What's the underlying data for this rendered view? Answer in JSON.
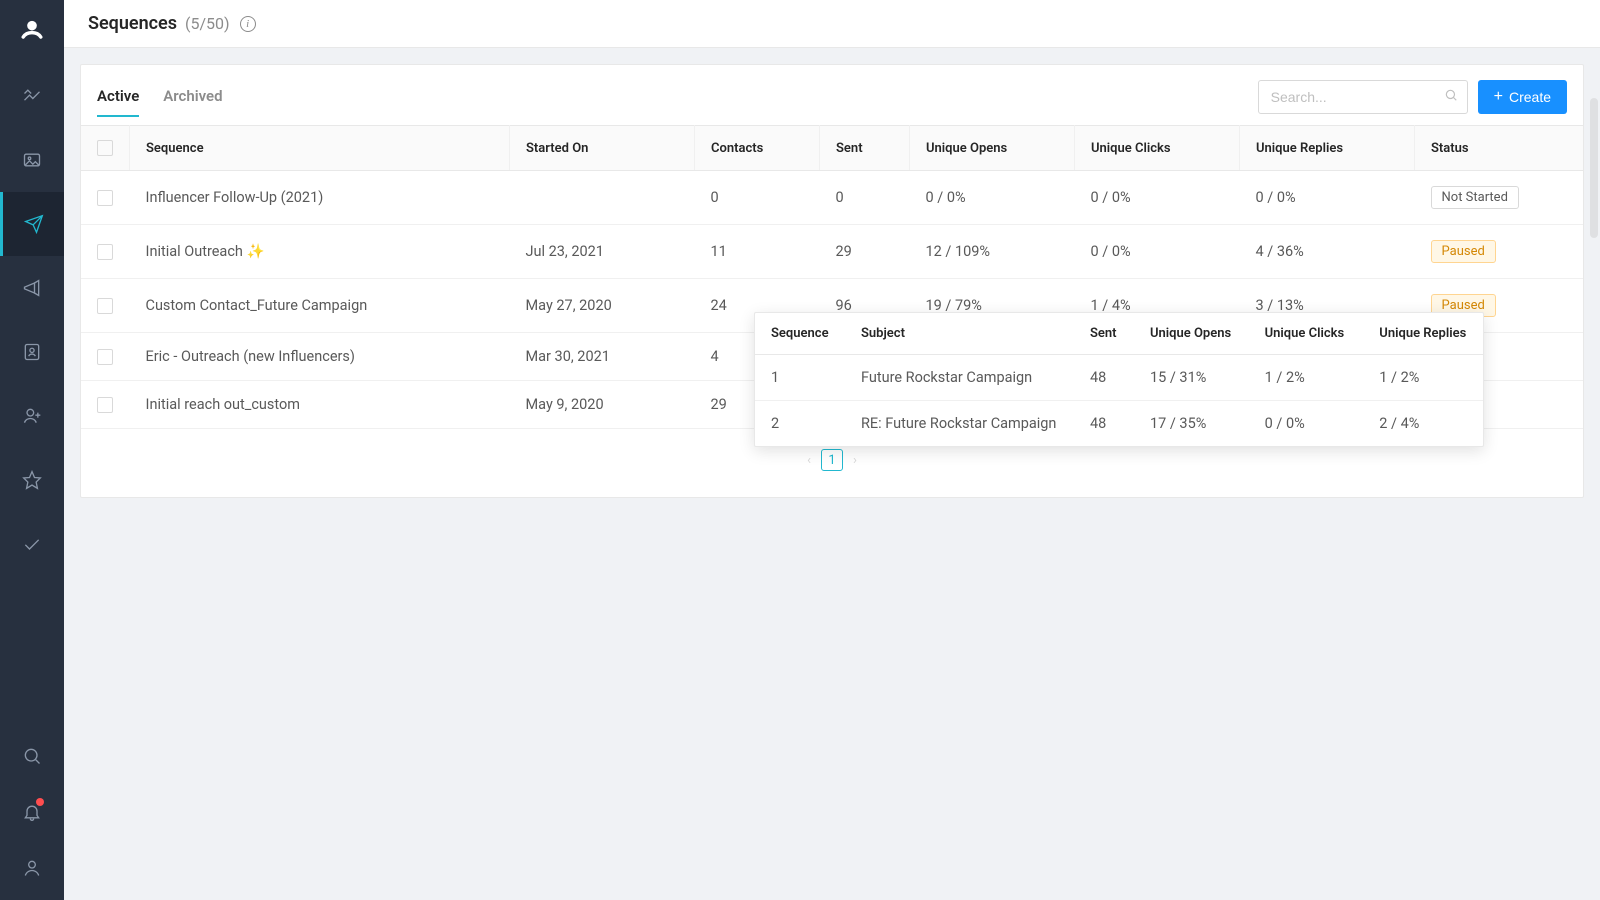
{
  "header": {
    "title": "Sequences",
    "count": "(5/50)",
    "info_glyph": "i"
  },
  "tabs": {
    "active": "Active",
    "archived": "Archived"
  },
  "search": {
    "placeholder": "Search..."
  },
  "create_button": {
    "label": "Create",
    "plus": "+"
  },
  "columns": {
    "sequence": "Sequence",
    "started_on": "Started On",
    "contacts": "Contacts",
    "sent": "Sent",
    "unique_opens": "Unique Opens",
    "unique_clicks": "Unique Clicks",
    "unique_replies": "Unique Replies",
    "status": "Status"
  },
  "status_labels": {
    "not_started": "Not Started",
    "paused": "Paused"
  },
  "rows": [
    {
      "name": "Influencer Follow-Up (2021)",
      "started_on": "",
      "contacts": "0",
      "sent": "0",
      "opens": "0 / 0%",
      "clicks": "0 / 0%",
      "replies": "0 / 0%",
      "status": "not_started"
    },
    {
      "name": "Initial Outreach ✨",
      "started_on": "Jul 23, 2021",
      "contacts": "11",
      "sent": "29",
      "opens": "12 / 109%",
      "clicks": "0 / 0%",
      "replies": "4 / 36%",
      "status": "paused"
    },
    {
      "name": "Custom Contact_Future Campaign",
      "started_on": "May 27, 2020",
      "contacts": "24",
      "sent": "96",
      "opens": "19 / 79%",
      "clicks": "1 / 4%",
      "replies": "3 / 13%",
      "status": "paused"
    },
    {
      "name": "Eric - Outreach (new Influencers)",
      "started_on": "Mar 30, 2021",
      "contacts": "4",
      "sent": "",
      "opens": "",
      "clicks": "",
      "replies": "",
      "status": ""
    },
    {
      "name": "Initial reach out_custom",
      "started_on": "May 9, 2020",
      "contacts": "29",
      "sent": "",
      "opens": "",
      "clicks": "",
      "replies": "",
      "status": ""
    }
  ],
  "pagination": {
    "prev": "‹",
    "page": "1",
    "next": "›"
  },
  "popover": {
    "headers": {
      "sequence": "Sequence",
      "subject": "Subject",
      "sent": "Sent",
      "unique_opens": "Unique Opens",
      "unique_clicks": "Unique Clicks",
      "unique_replies": "Unique Replies"
    },
    "rows": [
      {
        "seq": "1",
        "subject": "Future Rockstar Campaign",
        "sent": "48",
        "opens": "15 / 31%",
        "clicks": "1 / 2%",
        "replies": "1 / 2%"
      },
      {
        "seq": "2",
        "subject": "RE: Future Rockstar Campaign",
        "sent": "48",
        "opens": "17 / 35%",
        "clicks": "0 / 0%",
        "replies": "2 / 4%"
      }
    ]
  }
}
